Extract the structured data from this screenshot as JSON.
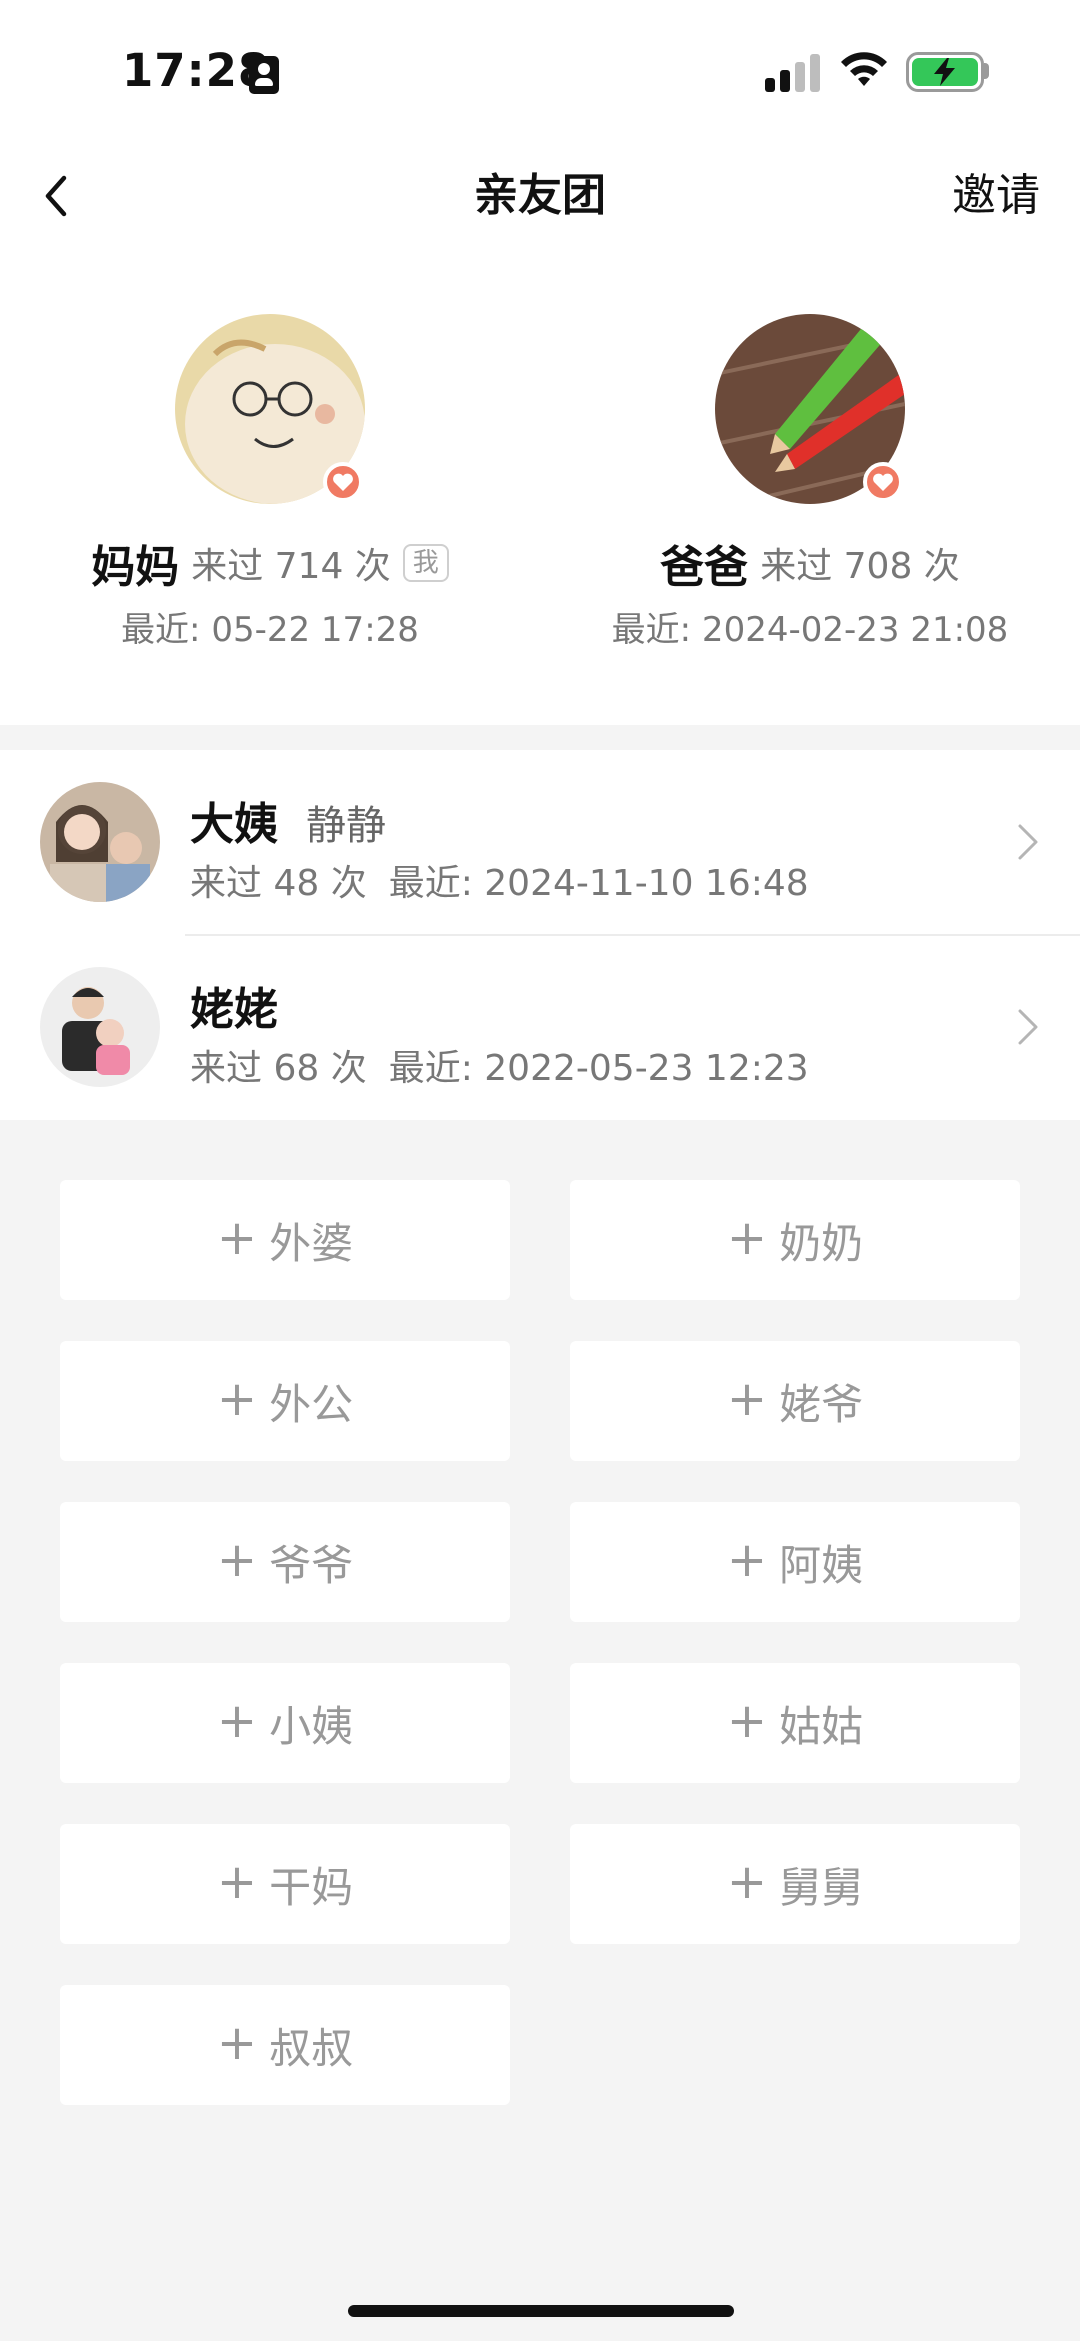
{
  "status": {
    "time": "17:28"
  },
  "nav": {
    "title": "亲友团",
    "invite": "邀请"
  },
  "parents": [
    {
      "name": "妈妈",
      "visits": "来过 714 次",
      "me_tag": "我",
      "recent": "最近: 05-22 17:28"
    },
    {
      "name": "爸爸",
      "visits": "来过 708 次",
      "recent": "最近: 2024-02-23 21:08"
    }
  ],
  "relatives": [
    {
      "name": "大姨",
      "nickname": "静静",
      "visits": "来过 48 次",
      "recent": "最近: 2024-11-10 16:48"
    },
    {
      "name": "姥姥",
      "visits": "来过 68 次",
      "recent": "最近: 2022-05-23 12:23"
    }
  ],
  "add_buttons": [
    "外婆",
    "奶奶",
    "外公",
    "姥爷",
    "爷爷",
    "阿姨",
    "小姨",
    "姑姑",
    "干妈",
    "舅舅",
    "叔叔"
  ],
  "icons": {
    "back": "chevron-left-icon",
    "heart": "heart-icon",
    "chevron": "chevron-right-icon",
    "plus": "plus-icon"
  },
  "colors": {
    "heart_badge": "#f07a63",
    "battery": "#34c759"
  }
}
